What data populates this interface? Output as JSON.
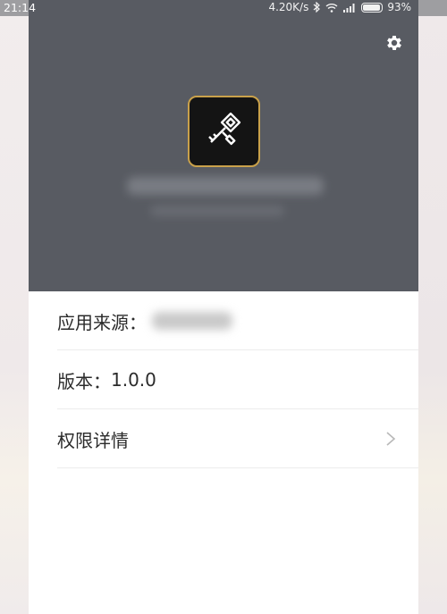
{
  "status_bar": {
    "time": "21:14",
    "network_speed": "4.20K/s",
    "battery_percent": "93%",
    "icons": [
      "bluetooth-icon",
      "wifi-icon",
      "signal-icon",
      "battery-icon"
    ]
  },
  "header": {
    "background_color": "#585b62",
    "settings_icon": "gear-icon",
    "app_icon": "key-icon",
    "app_icon_border_color": "#c9a14a"
  },
  "details": {
    "source_label": "应用来源：",
    "version_label": "版本：",
    "version_value": "1.0.0",
    "permissions_label": "权限详情",
    "permissions_icon": "chevron-right-icon"
  }
}
